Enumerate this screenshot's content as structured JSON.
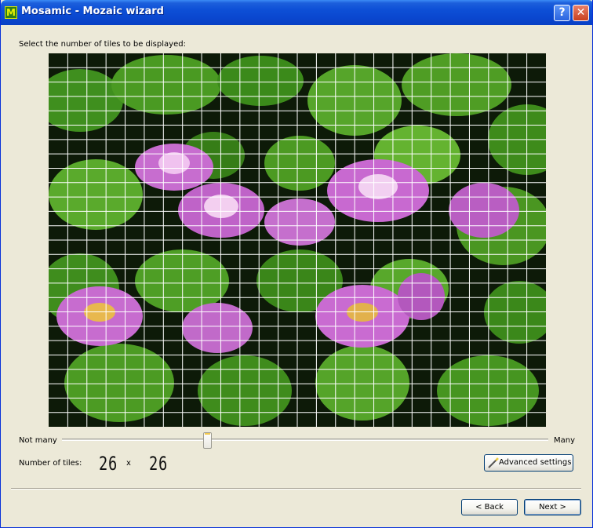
{
  "window": {
    "title": "Mosamic - Mozaic wizard",
    "icon_letter": "M",
    "help_glyph": "?",
    "close_glyph": "✕"
  },
  "prompt": "Select the number of tiles to be displayed:",
  "image": {
    "grid_columns": 26,
    "grid_rows": 26,
    "grid_color": "#ffffff"
  },
  "slider": {
    "min_label": "Not many",
    "max_label": "Many"
  },
  "tiles": {
    "label": "Number of tiles:",
    "columns": "26",
    "times": "x",
    "rows": "26"
  },
  "buttons": {
    "advanced_settings": "Advanced settings",
    "back": "< Back",
    "next": "Next >"
  },
  "icons": {
    "app": "mosamic-app-icon",
    "help": "help-icon",
    "close": "close-icon",
    "advanced": "wand-icon"
  },
  "colors": {
    "titlebar": "#0a47cf",
    "dialog_bg": "#ece9d8",
    "button_border": "#003c74"
  }
}
